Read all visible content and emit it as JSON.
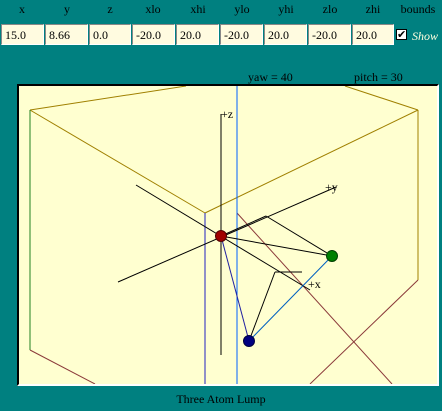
{
  "headers": {
    "x": "x",
    "y": "y",
    "z": "z",
    "xlo": "xlo",
    "xhi": "xhi",
    "ylo": "ylo",
    "yhi": "yhi",
    "zlo": "zlo",
    "zhi": "zhi",
    "bounds": "bounds"
  },
  "fields": {
    "x": "15.0",
    "y": "8.66",
    "z": "0.0",
    "xlo": "-20.0",
    "xhi": "20.0",
    "ylo": "-20.0",
    "yhi": "20.0",
    "zlo": "-20.0",
    "zhi": "20.0"
  },
  "bounds_checkbox": {
    "checked": true,
    "mark": "✔",
    "label": "Show"
  },
  "view": {
    "yaw_text": "yaw = 40",
    "pitch_text": "pitch = 30",
    "axis_labels": {
      "z": "+z",
      "y": "+y",
      "x": "+x"
    },
    "colors": {
      "background": "#ffffd0",
      "box_edges": "#8b3a3a",
      "box_olive": "#a08000",
      "box_green": "#208020",
      "axes": "#000000",
      "vertical_line_1": "#2020c0",
      "vertical_line_2": "#0060ff",
      "atom_red": "#a00000",
      "atom_green": "#008000",
      "atom_blue": "#000080",
      "bond_blue": "#0060c0"
    }
  },
  "caption": "Three Atom Lump"
}
